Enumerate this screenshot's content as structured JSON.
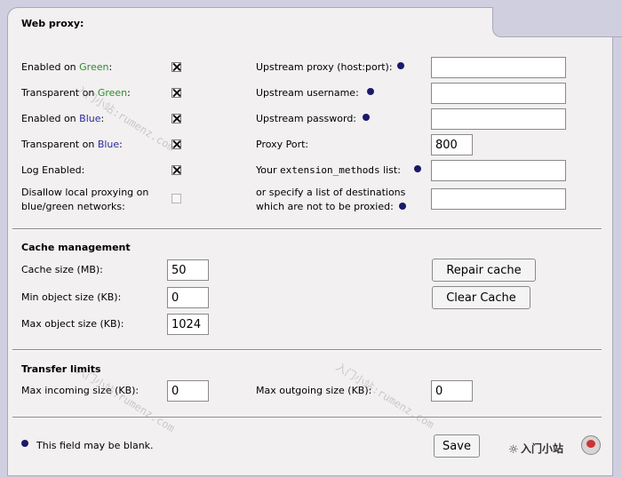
{
  "title": "Web proxy:",
  "checkboxes": {
    "enabled_green": {
      "prefix": "Enabled on ",
      "color": "Green",
      "suffix": ":",
      "checked": true
    },
    "transparent_green": {
      "prefix": "Transparent on ",
      "color": "Green",
      "suffix": ":",
      "checked": true
    },
    "enabled_blue": {
      "prefix": "Enabled on ",
      "color": "Blue",
      "suffix": ":",
      "checked": true
    },
    "transparent_blue": {
      "prefix": "Transparent on ",
      "color": "Blue",
      "suffix": ":",
      "checked": true
    },
    "log_enabled": {
      "label": "Log Enabled:",
      "checked": true
    },
    "disallow_local": {
      "label_line1": "Disallow local proxying on",
      "label_line2": "blue/green networks:",
      "checked": false
    }
  },
  "right": {
    "upstream_proxy": {
      "label": "Upstream proxy (host:port):",
      "value": ""
    },
    "upstream_username": {
      "label": "Upstream username:",
      "value": ""
    },
    "upstream_password": {
      "label": "Upstream password:",
      "value": ""
    },
    "proxy_port": {
      "label": "Proxy Port:",
      "value": "800"
    },
    "ext_methods": {
      "label_pre": "Your ",
      "label_mono": "extension_methods",
      "label_post": " list:",
      "value": ""
    },
    "no_proxy": {
      "label_line1": "or specify a list of destinations",
      "label_line2": "which are not to be proxied:",
      "value": ""
    }
  },
  "cache": {
    "heading": "Cache management",
    "cache_size": {
      "label": "Cache size (MB):",
      "value": "50"
    },
    "min_obj": {
      "label": "Min object size (KB):",
      "value": "0"
    },
    "max_obj": {
      "label": "Max object size (KB):",
      "value": "1024"
    },
    "repair_label": "Repair cache",
    "clear_label": "Clear Cache"
  },
  "transfer": {
    "heading": "Transfer limits",
    "max_in": {
      "label": "Max incoming size (KB):",
      "value": "0"
    },
    "max_out": {
      "label": "Max outgoing size (KB):",
      "value": "0"
    }
  },
  "footer": {
    "note": "This field may be blank.",
    "save_label": "Save",
    "logo_text": "入门小站"
  },
  "watermark": "入门小站:rumenz.com",
  "colors": {
    "green": "#2f8a2f",
    "blue": "#2b2b9a",
    "dot": "#1a1a6a"
  }
}
